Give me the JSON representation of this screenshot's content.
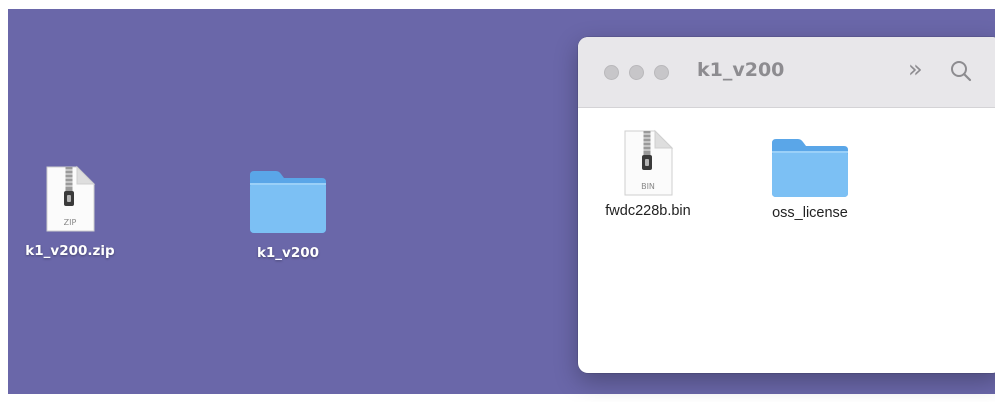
{
  "desktop": {
    "background": "#6a67a9",
    "items": [
      {
        "label": "k1_v200.zip",
        "kind": "archive",
        "badge": "ZIP",
        "icon": "zip-file-icon"
      },
      {
        "label": "k1_v200",
        "kind": "folder",
        "icon": "folder-icon"
      }
    ]
  },
  "window": {
    "title": "k1_v200",
    "toolbar": {
      "more_glyph": "»",
      "search_icon": "magnifier-icon"
    },
    "items": [
      {
        "label": "fwdc228b.bin",
        "kind": "binary",
        "badge": "BIN",
        "icon": "bin-file-icon"
      },
      {
        "label": "oss_license",
        "kind": "folder",
        "icon": "folder-icon"
      }
    ]
  },
  "colors": {
    "folder_body": "#7cc0f4",
    "folder_tab": "#5aa6e8",
    "titlebar": "#e8e7ea",
    "title_text": "#8d8c90"
  }
}
